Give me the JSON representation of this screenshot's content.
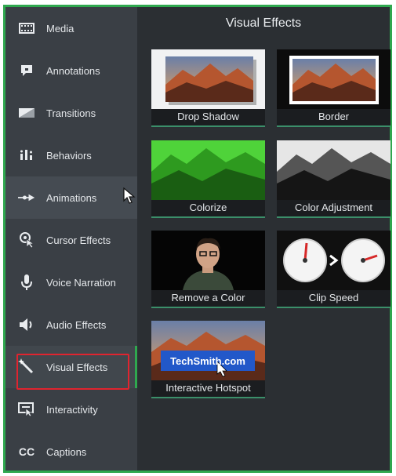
{
  "sidebar": {
    "items": [
      {
        "label": "Media",
        "icon": "film-icon"
      },
      {
        "label": "Annotations",
        "icon": "annotation-icon"
      },
      {
        "label": "Transitions",
        "icon": "transition-icon"
      },
      {
        "label": "Behaviors",
        "icon": "behaviors-icon"
      },
      {
        "label": "Animations",
        "icon": "animation-arrow-icon"
      },
      {
        "label": "Cursor Effects",
        "icon": "cursor-effects-icon"
      },
      {
        "label": "Voice Narration",
        "icon": "microphone-icon"
      },
      {
        "label": "Audio Effects",
        "icon": "speaker-icon"
      },
      {
        "label": "Visual Effects",
        "icon": "magic-wand-icon"
      },
      {
        "label": "Interactivity",
        "icon": "interactivity-icon"
      },
      {
        "label": "Captions",
        "icon": "cc-icon"
      }
    ]
  },
  "main": {
    "title": "Visual Effects",
    "effects": [
      {
        "label": "Drop Shadow"
      },
      {
        "label": "Border"
      },
      {
        "label": "Colorize"
      },
      {
        "label": "Color Adjustment"
      },
      {
        "label": "Remove a Color"
      },
      {
        "label": "Clip Speed"
      },
      {
        "label": "Interactive Hotspot",
        "overlay_text": "TechSmith.com"
      }
    ]
  },
  "colors": {
    "accent_green": "#2fa84f",
    "highlight_red": "#e0242f",
    "sidebar_bg": "#3a3f45",
    "panel_bg": "#2b2f33"
  }
}
